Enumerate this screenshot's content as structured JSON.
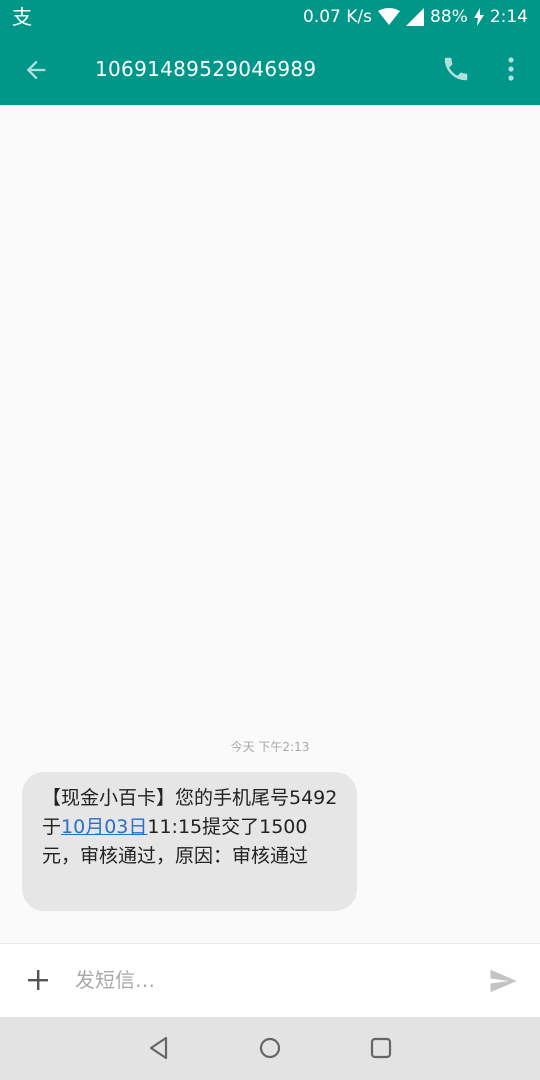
{
  "status_bar": {
    "app_icon": "alipay-icon",
    "network_speed": "0.07 K/s",
    "battery": "88%",
    "time": "2:14"
  },
  "app_bar": {
    "title": "10691489529046989",
    "back_icon": "arrow-back-icon",
    "call_icon": "phone-icon",
    "more_icon": "more-vert-icon"
  },
  "conversation": {
    "timestamp": "今天 下午2:13",
    "message": {
      "part1": "【现金小百卡】您的手机尾号5492于",
      "link": "10月03日",
      "part2": "11:15提交了1500元，审核通过，原因：审核通过"
    }
  },
  "compose": {
    "placeholder": "发短信…"
  },
  "colors": {
    "primary": "#009688",
    "bubble": "#e6e6e6",
    "link": "#2a6fc9"
  }
}
